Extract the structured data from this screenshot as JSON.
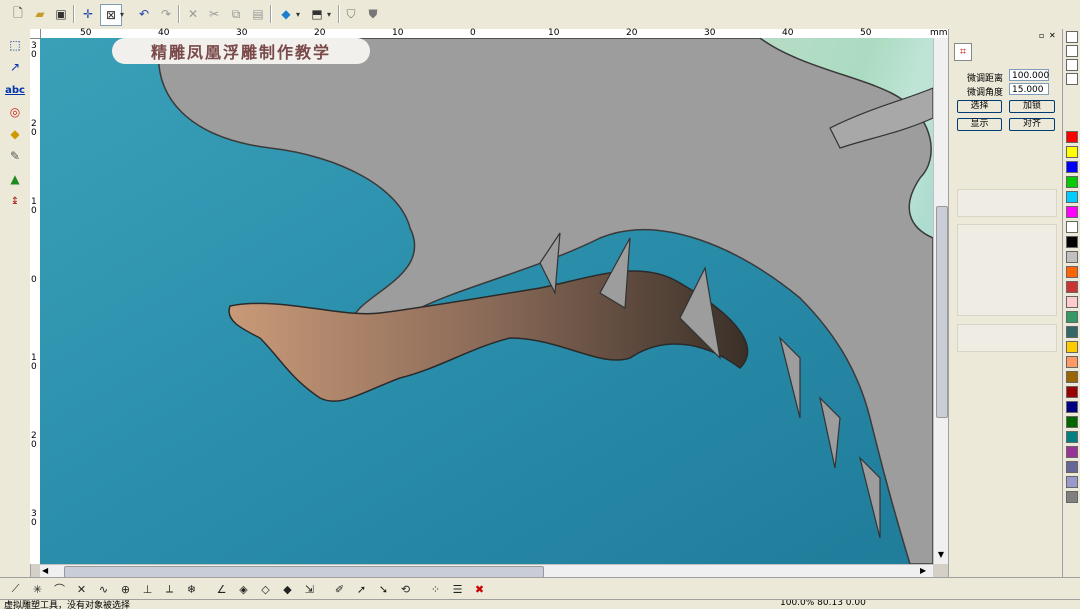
{
  "toolbar": {
    "items": [
      "new-file-icon",
      "open-folder-icon",
      "save-icon",
      "crosshair-icon",
      "select-box-icon",
      "undo-icon",
      "redo-icon",
      "delete-icon",
      "cut-icon",
      "copy-icon",
      "paste-icon",
      "shape-3d-icon",
      "view-3d-icon",
      "shield-outline-icon",
      "shield-solid-icon"
    ]
  },
  "left_tools": [
    "rect-select-icon",
    "node-edit-icon",
    "text-tool-icon",
    "circle-tool-icon",
    "fill-tool-icon",
    "pen-tool-icon",
    "relief-tool-icon",
    "measure-tool-icon"
  ],
  "left_tools_text": {
    "text_tool": "abc"
  },
  "ruler": {
    "unit": "mm",
    "h_labels": [
      "50",
      "40",
      "30",
      "20",
      "10",
      "0",
      "10",
      "20",
      "30",
      "40",
      "50"
    ],
    "v_labels": [
      "3 0",
      "2 0",
      "1 0",
      "0",
      "1 0",
      "2 0",
      "3 0"
    ]
  },
  "canvas": {
    "title_badge": "精雕凤凰浮雕制作教学"
  },
  "panel": {
    "header_icon": "node-tool-icon",
    "field1_label": "微调距离",
    "field1_value": "100.000",
    "field2_label": "微调角度",
    "field2_value": "15.000",
    "btn_select": "选择",
    "btn_add_lock": "加锁",
    "btn_show": "显示",
    "btn_align": "对齐"
  },
  "palette": {
    "colors": [
      "#ff0000",
      "#ffff00",
      "#0000ff",
      "#00cc00",
      "#00ccff",
      "#ff00ff",
      "#ffffff",
      "#000000",
      "#c0c0c0",
      "#ff6600",
      "#cc3333",
      "#ffcccc",
      "#339966",
      "#336666",
      "#ffcc00",
      "#ff9966",
      "#996600",
      "#990000",
      "#000080",
      "#006600",
      "#008080",
      "#993399",
      "#666699",
      "#9999cc",
      "#808080"
    ]
  },
  "bottom_tools": [
    "line-tool-icon",
    "star-tool-icon",
    "arc-tool-icon",
    "cross-tool-icon",
    "curve-tool-icon",
    "circle-target-icon",
    "perpendicular-icon",
    "tangent-icon",
    "snowflake-icon",
    "angle-icon",
    "diamond-icon",
    "diamond-arrow-icon",
    "diamond-node-icon",
    "cursor-mark-icon",
    "ruler-pencil-icon",
    "cursor-add-icon",
    "cursor-delete-icon",
    "transform-icon",
    "scatter-icon",
    "edit-list-icon",
    "close-red-icon"
  ],
  "status": {
    "text": "虚拟雕塑工具，没有对象被选择",
    "right": "100.0%  80.13  0.00"
  }
}
